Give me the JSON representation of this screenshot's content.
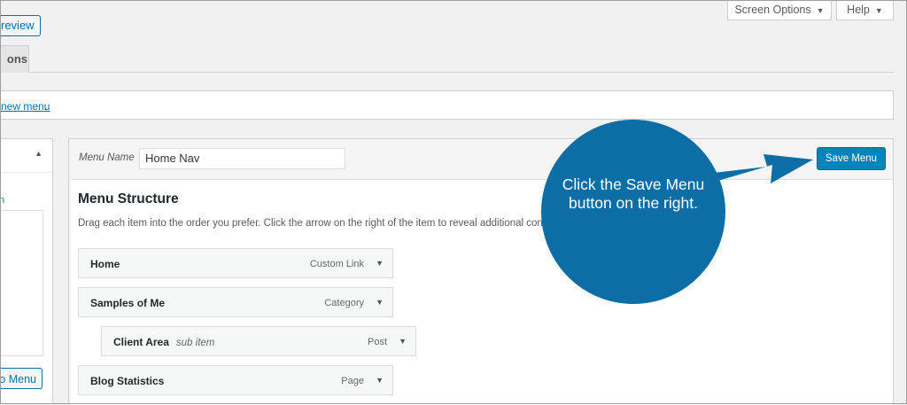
{
  "top": {
    "preview_label": "review",
    "screen_options_label": "Screen Options",
    "help_label": "Help",
    "tab_label": "ons"
  },
  "notice": {
    "link_text": "new menu",
    "suffix": "."
  },
  "left_panel": {
    "tiny_link": "n",
    "add_button_label": "o Menu"
  },
  "menu": {
    "name_label": "Menu Name",
    "name_value": "Home Nav",
    "save_label": "Save Menu",
    "structure_title": "Menu Structure",
    "structure_desc": "Drag each item into the order you prefer. Click the arrow on the right of the item to reveal additional configuration options.",
    "items": [
      {
        "title": "Home",
        "sub": "",
        "type": "Custom Link"
      },
      {
        "title": "Samples of Me",
        "sub": "",
        "type": "Category"
      },
      {
        "title": "Client Area",
        "sub": "sub item",
        "type": "Post"
      },
      {
        "title": "Blog Statistics",
        "sub": "",
        "type": "Page"
      }
    ]
  },
  "callout": {
    "line1": "Click the Save Menu",
    "line2": "button on the right.",
    "color": "#0d6ea5"
  },
  "colors": {
    "accent": "#0073aa",
    "primary_button": "#0085ba"
  }
}
